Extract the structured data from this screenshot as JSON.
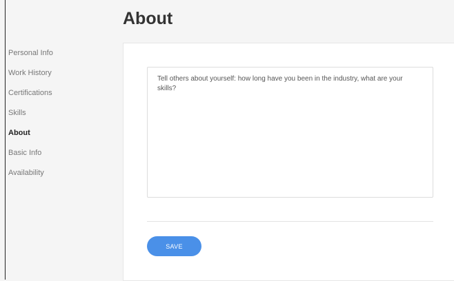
{
  "header": {
    "title": "About"
  },
  "sidebar": {
    "items": [
      {
        "label": "Personal Info",
        "active": false
      },
      {
        "label": "Work History",
        "active": false
      },
      {
        "label": "Certifications",
        "active": false
      },
      {
        "label": "Skills",
        "active": false
      },
      {
        "label": "About",
        "active": true
      },
      {
        "label": "Basic Info",
        "active": false
      },
      {
        "label": "Availability",
        "active": false
      }
    ]
  },
  "about_form": {
    "textarea_value": "",
    "textarea_placeholder": "Tell others about yourself: how long have you been in the industry, what are your skills?",
    "save_label": "SAVE"
  },
  "colors": {
    "accent": "#4a90e8",
    "active_text": "#222222",
    "inactive_text": "#777777",
    "page_background": "#f5f5f5",
    "card_background": "#ffffff"
  }
}
